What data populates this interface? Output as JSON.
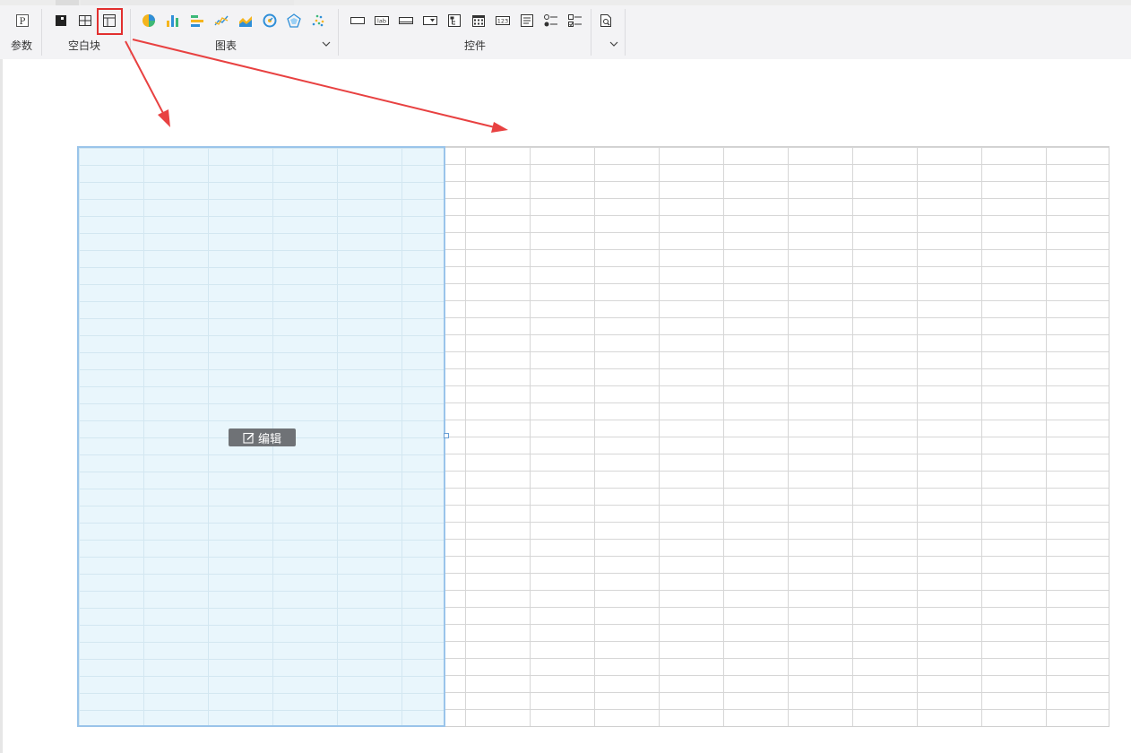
{
  "toolbar": {
    "groups": {
      "param": {
        "label": "参数"
      },
      "blank": {
        "label": "空白块"
      },
      "chart": {
        "label": "图表"
      },
      "widget": {
        "label": "控件"
      }
    },
    "icons": {
      "param": [
        "p-param-icon"
      ],
      "blank": [
        "dark-block-icon",
        "grid-block-icon",
        "table-block-icon"
      ],
      "chart": [
        "pie-chart-icon",
        "bar-chart-icon",
        "horizontal-bar-icon",
        "line-chart-icon",
        "area-chart-icon",
        "gauge-chart-icon",
        "radar-chart-icon",
        "scatter-chart-icon"
      ],
      "widget": [
        "text-field-icon",
        "label-icon",
        "button-icon",
        "dropdown-icon",
        "tree-icon",
        "date-icon",
        "number-icon",
        "text-area-icon",
        "radio-group-icon",
        "checkbox-group-icon",
        "query-icon"
      ]
    },
    "label_texts": {
      "lab": "lab",
      "num": "123"
    }
  },
  "canvas": {
    "edit_label": "编辑"
  },
  "colors": {
    "accent_red": "#e22f2f",
    "selection_fill": "#e9f6fc",
    "selection_border": "#9ac4ea"
  }
}
